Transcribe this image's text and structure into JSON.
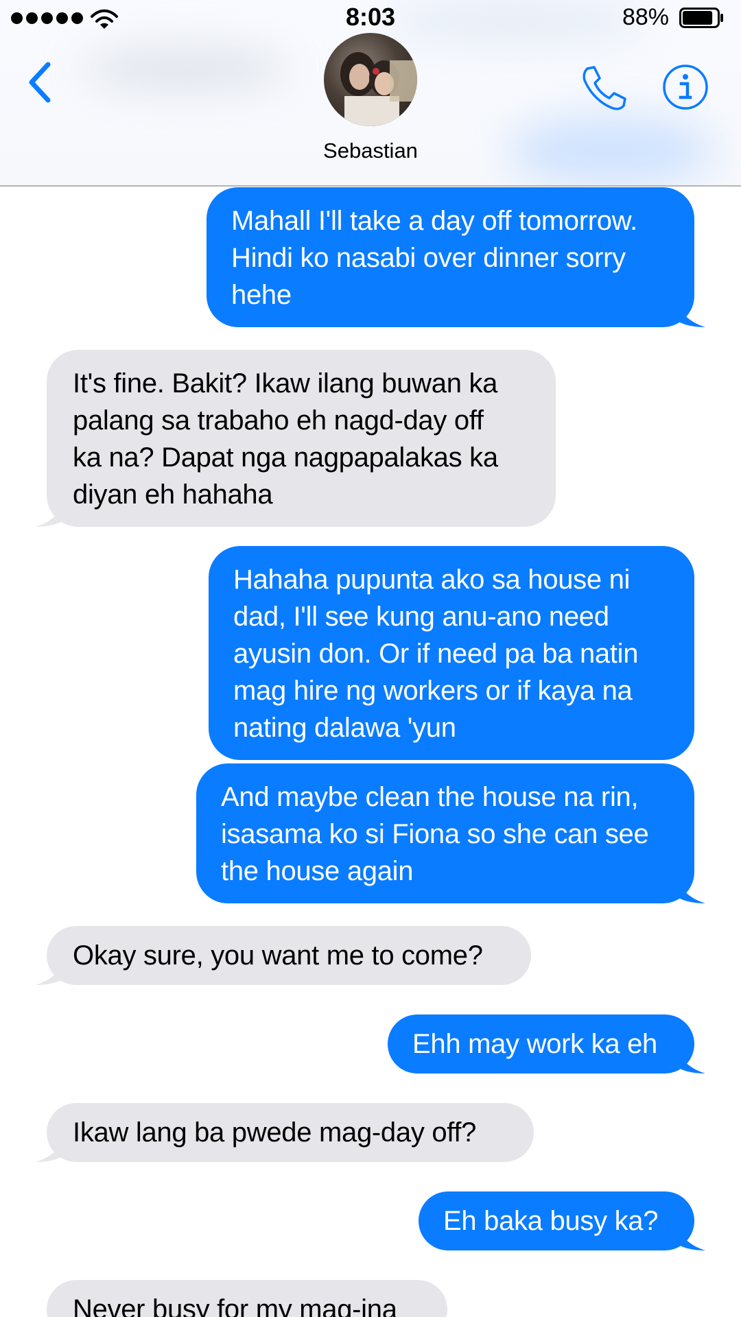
{
  "status_bar": {
    "signal_bars": 5,
    "time": "8:03",
    "battery_percent": "88%",
    "battery_level": 0.88
  },
  "header": {
    "contact_name": "Sebastian",
    "icons": {
      "back": "chevron-left-icon",
      "call": "phone-icon",
      "info": "info-icon"
    },
    "accent_color": "#0a7cff"
  },
  "colors": {
    "outgoing_bubble": "#0a7cff",
    "incoming_bubble": "#e6e5ea"
  },
  "messages": [
    {
      "direction": "outgoing",
      "text": "Mahall I'll take a day off tomorrow.\nHindi ko nasabi over dinner sorry\nhehe"
    },
    {
      "direction": "incoming",
      "text": "It's fine. Bakit? Ikaw ilang buwan ka\npalang sa trabaho eh nagd-day off\nka na? Dapat nga nagpapalakas ka\ndiyan eh hahaha"
    },
    {
      "direction": "outgoing",
      "text": "Hahaha pupunta ako sa house ni\ndad, I'll see kung anu-ano need\nayusin don. Or if need pa ba natin\nmag hire ng workers or if kaya na\nnating dalawa 'yun"
    },
    {
      "direction": "outgoing",
      "text": "And maybe clean the house na rin,\nisasama ko si Fiona so she can see\nthe house again"
    },
    {
      "direction": "incoming",
      "text": "Okay sure, you want me to come?"
    },
    {
      "direction": "outgoing",
      "text": "Ehh may work ka eh"
    },
    {
      "direction": "incoming",
      "text": "Ikaw lang ba pwede mag-day off?"
    },
    {
      "direction": "outgoing",
      "text": "Eh baka busy ka?"
    },
    {
      "direction": "incoming",
      "text": "Never busy for my mag-ina"
    }
  ]
}
